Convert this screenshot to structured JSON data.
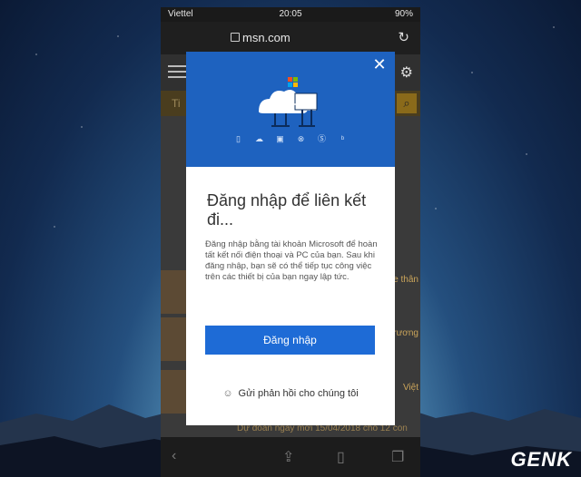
{
  "status": {
    "carrier": "Viettel",
    "time": "20:05",
    "battery": "90%"
  },
  "browser": {
    "url": "msn.com",
    "search_placeholder": "Ti"
  },
  "background_texts": {
    "side_snippet_1": "e thân",
    "side_snippet_2": "rương",
    "side_snippet_3": "Việt",
    "bottom_snippet": "Dự đoán ngày mới 15/04/2018 cho 12 con"
  },
  "modal": {
    "close_icon": "close-icon",
    "app_icons": [
      "office-icon",
      "onedrive-icon",
      "outlook-icon",
      "xbox-icon",
      "skype-icon",
      "bing-icon"
    ],
    "title": "Đăng nhập để liên kết đi...",
    "description": "Đăng nhập bằng tài khoản Microsoft để hoàn tất kết nối điện thoại và PC của bạn. Sau khi đăng nhập, bạn sẽ có thể tiếp tục công việc trên các thiết bị của bạn ngay lập tức.",
    "signin_label": "Đăng nhập",
    "feedback_label": "Gửi phản hồi cho chúng tôi"
  },
  "watermark": "GENK",
  "colors": {
    "hero": "#1e62bf",
    "button": "#1e6bd6"
  }
}
